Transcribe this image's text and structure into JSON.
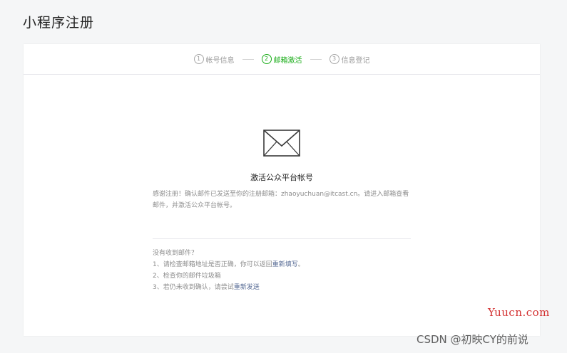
{
  "page": {
    "title": "小程序注册"
  },
  "steps": [
    {
      "num": "1",
      "label": "帐号信息"
    },
    {
      "num": "2",
      "label": "邮箱激活"
    },
    {
      "num": "3",
      "label": "信息登记"
    }
  ],
  "active_step": 2,
  "colors": {
    "accent": "#1aad19",
    "link": "#576b95",
    "muted_text": "#8d8d8d"
  },
  "main": {
    "icon": "envelope-icon",
    "title": "激活公众平台帐号",
    "description": "感谢注册！确认邮件已发送至你的注册邮箱：zhaoyuchuan@itcast.cn。请进入邮箱查看邮件，并激活公众平台帐号。"
  },
  "help": {
    "heading": "没有收到邮件？",
    "item1_text": "1、请检查邮箱地址是否正确，你可以返回",
    "item1_link": "重新填写",
    "item1_end": "。",
    "item2_text": "2、检查你的邮件垃圾箱",
    "item3_text": "3、若仍未收到确认，请尝试",
    "item3_link": "重新发送"
  },
  "watermarks": {
    "site": "Yuucn.com",
    "csdn": "CSDN @初映CY的前说"
  }
}
